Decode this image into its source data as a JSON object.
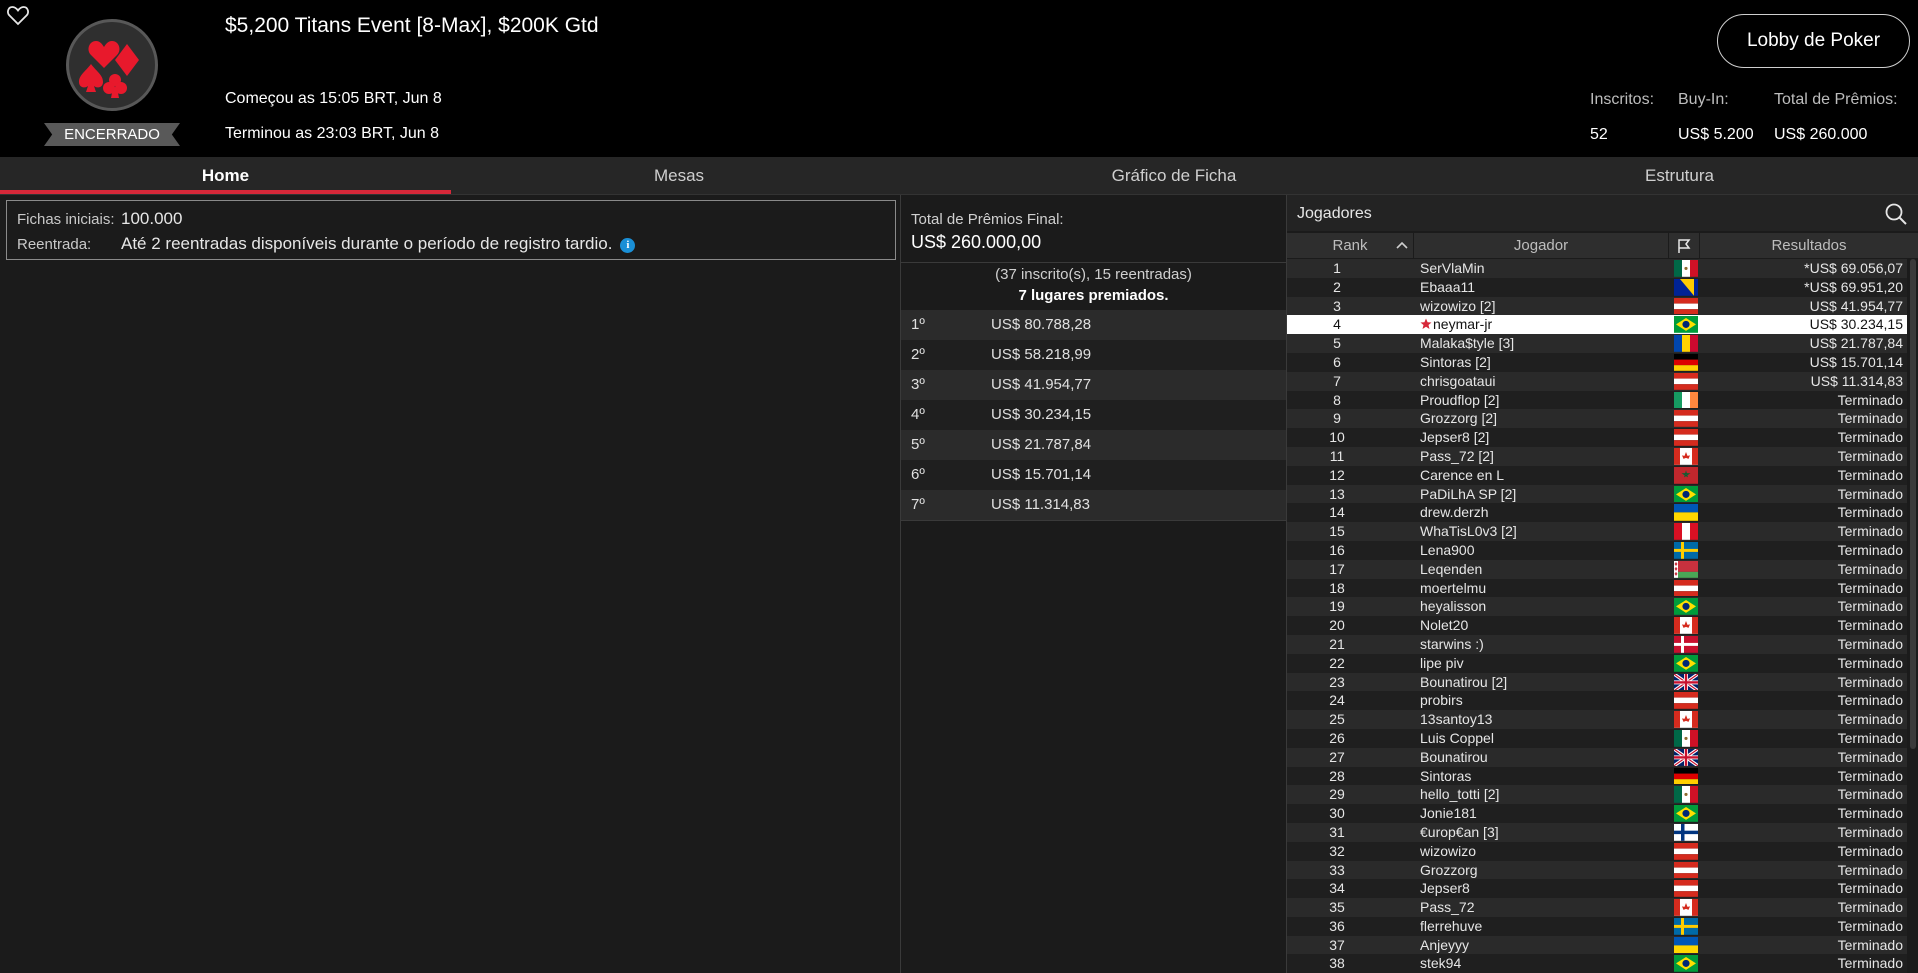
{
  "tournament": {
    "title": "$5,200 Titans Event [8-Max], $200K Gtd",
    "status": "ENCERRADO",
    "started": "Começou as 15:05 BRT, Jun 8",
    "ended": "Terminou as 23:03 BRT, Jun 8",
    "lobby_button": "Lobby de Poker",
    "stats": [
      {
        "label": "Inscritos:",
        "value": "52"
      },
      {
        "label": "Buy-In:",
        "value": "US$ 5.200"
      },
      {
        "label": "Total de Prêmios:",
        "value": "US$ 260.000"
      }
    ]
  },
  "tabs": [
    {
      "label": "Home"
    },
    {
      "label": "Mesas"
    },
    {
      "label": "Gráfico de Ficha"
    },
    {
      "label": "Estrutura"
    }
  ],
  "info": {
    "chips_label": "Fichas iniciais:",
    "chips_value": "100.000",
    "reentry_label": "Reentrada:",
    "reentry_value": "Até 2 reentradas disponíveis durante o período de registro tardio."
  },
  "prizes": {
    "total_label": "Total de Prêmios Final:",
    "total_value": "US$ 260.000,00",
    "entries": "(37 inscrito(s), 15 reentradas)",
    "places": "7 lugares premiados.",
    "list": [
      {
        "pos": "1º",
        "amount": "US$ 80.788,28"
      },
      {
        "pos": "2º",
        "amount": "US$ 58.218,99"
      },
      {
        "pos": "3º",
        "amount": "US$ 41.954,77"
      },
      {
        "pos": "4º",
        "amount": "US$ 30.234,15"
      },
      {
        "pos": "5º",
        "amount": "US$ 21.787,84"
      },
      {
        "pos": "6º",
        "amount": "US$ 15.701,14"
      },
      {
        "pos": "7º",
        "amount": "US$ 11.314,83"
      }
    ]
  },
  "players": {
    "title": "Jogadores",
    "columns": {
      "rank": "Rank",
      "player": "Jogador",
      "results": "Resultados"
    },
    "rows": [
      {
        "rank": "1",
        "name": "SerVlaMin",
        "flag": "mx",
        "result": "*US$ 69.056,07"
      },
      {
        "rank": "2",
        "name": "Ebaaa11",
        "flag": "ba",
        "result": "*US$ 69.951,20"
      },
      {
        "rank": "3",
        "name": "wizowizo [2]",
        "flag": "at",
        "result": "US$ 41.954,77"
      },
      {
        "rank": "4",
        "name": "neymar-jr",
        "flag": "br",
        "result": "US$ 30.234,15",
        "highlight": true,
        "pro": true
      },
      {
        "rank": "5",
        "name": "Malaka$tyle [3]",
        "flag": "md",
        "result": "US$ 21.787,84"
      },
      {
        "rank": "6",
        "name": "Sintoras [2]",
        "flag": "de",
        "result": "US$ 15.701,14"
      },
      {
        "rank": "7",
        "name": "chrisgoataui",
        "flag": "at",
        "result": "US$ 11.314,83"
      },
      {
        "rank": "8",
        "name": "Proudflop [2]",
        "flag": "ie",
        "result": "Terminado"
      },
      {
        "rank": "9",
        "name": "Grozzorg [2]",
        "flag": "at",
        "result": "Terminado"
      },
      {
        "rank": "10",
        "name": "Jepser8 [2]",
        "flag": "at",
        "result": "Terminado"
      },
      {
        "rank": "11",
        "name": "Pass_72 [2]",
        "flag": "ca",
        "result": "Terminado"
      },
      {
        "rank": "12",
        "name": "Carence en L",
        "flag": "ma",
        "result": "Terminado"
      },
      {
        "rank": "13",
        "name": "PaDiLhA SP [2]",
        "flag": "br",
        "result": "Terminado"
      },
      {
        "rank": "14",
        "name": "drew.derzh",
        "flag": "ua",
        "result": "Terminado"
      },
      {
        "rank": "15",
        "name": "WhaTisL0v3 [2]",
        "flag": "pe",
        "result": "Terminado"
      },
      {
        "rank": "16",
        "name": "Lena900",
        "flag": "se",
        "result": "Terminado"
      },
      {
        "rank": "17",
        "name": "Leqenden",
        "flag": "by",
        "result": "Terminado"
      },
      {
        "rank": "18",
        "name": "moertelmu",
        "flag": "at",
        "result": "Terminado"
      },
      {
        "rank": "19",
        "name": "heyalisson",
        "flag": "br",
        "result": "Terminado"
      },
      {
        "rank": "20",
        "name": "Nolet20",
        "flag": "ca",
        "result": "Terminado"
      },
      {
        "rank": "21",
        "name": "starwins :)",
        "flag": "dk",
        "result": "Terminado"
      },
      {
        "rank": "22",
        "name": "lipe piv",
        "flag": "br",
        "result": "Terminado"
      },
      {
        "rank": "23",
        "name": "Bounatirou [2]",
        "flag": "gb",
        "result": "Terminado"
      },
      {
        "rank": "24",
        "name": "probirs",
        "flag": "at",
        "result": "Terminado"
      },
      {
        "rank": "25",
        "name": "13santoy13",
        "flag": "ca",
        "result": "Terminado"
      },
      {
        "rank": "26",
        "name": "Luis Coppel",
        "flag": "mx",
        "result": "Terminado"
      },
      {
        "rank": "27",
        "name": "Bounatirou",
        "flag": "gb",
        "result": "Terminado"
      },
      {
        "rank": "28",
        "name": "Sintoras",
        "flag": "de",
        "result": "Terminado"
      },
      {
        "rank": "29",
        "name": "hello_totti [2]",
        "flag": "mx",
        "result": "Terminado"
      },
      {
        "rank": "30",
        "name": "Jonie181",
        "flag": "br",
        "result": "Terminado"
      },
      {
        "rank": "31",
        "name": "€urop€an [3]",
        "flag": "fi",
        "result": "Terminado"
      },
      {
        "rank": "32",
        "name": "wizowizo",
        "flag": "at",
        "result": "Terminado"
      },
      {
        "rank": "33",
        "name": "Grozzorg",
        "flag": "at",
        "result": "Terminado"
      },
      {
        "rank": "34",
        "name": "Jepser8",
        "flag": "at",
        "result": "Terminado"
      },
      {
        "rank": "35",
        "name": "Pass_72",
        "flag": "ca",
        "result": "Terminado"
      },
      {
        "rank": "36",
        "name": "flerrehuve",
        "flag": "se",
        "result": "Terminado"
      },
      {
        "rank": "37",
        "name": "Anjeyyy",
        "flag": "ua",
        "result": "Terminado"
      },
      {
        "rank": "38",
        "name": "stek94",
        "flag": "br",
        "result": "Terminado"
      }
    ]
  },
  "colors": {
    "accent": "#d62839",
    "info": "#1a8fd6",
    "highlight": "#ffffff"
  }
}
